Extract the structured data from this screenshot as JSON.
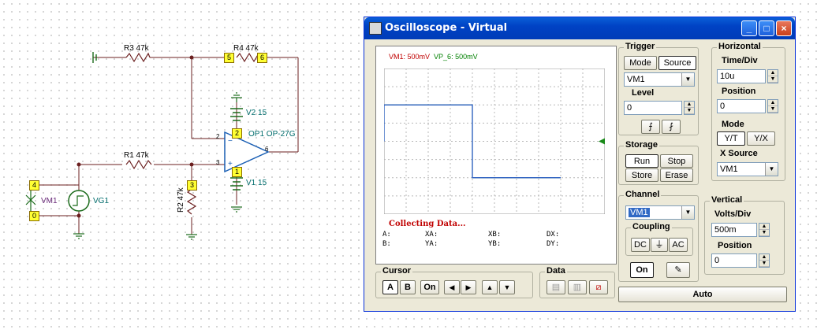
{
  "schematic": {
    "r3": "R3 47k",
    "r4": "R4 47k",
    "r1": "R1 47k",
    "r2": "R2 47k",
    "v2": "V2 15",
    "v1": "V1 15",
    "op1": "OP1 OP-27G",
    "vm1": "VM1",
    "vg1": "VG1",
    "nodes": {
      "n5": "5",
      "n6": "6",
      "n2": "2",
      "n1": "1",
      "n3": "3",
      "n4": "4",
      "n0": "0"
    },
    "pins": {
      "p2": "2",
      "p3": "3",
      "p6": "6"
    }
  },
  "window": {
    "title": "Oscilloscope - Virtual",
    "controls": {
      "minimize": "_",
      "maximize": "□",
      "close": "×"
    }
  },
  "screen": {
    "ch1": "VM1: 500mV",
    "ch2": "VP_6: 500mV",
    "status": "Collecting Data...",
    "cursors": {
      "a": "A:",
      "b": "B:",
      "xa": "XA:",
      "ya": "YA:",
      "xb": "XB:",
      "yb": "YB:",
      "dx": "DX:",
      "dy": "DY:"
    }
  },
  "trigger": {
    "title": "Trigger",
    "mode_label": "Mode",
    "source_label": "Source",
    "source_value": "VM1",
    "level_label": "Level",
    "level_value": "0",
    "rise_symbol": "⨍",
    "fall_symbol": "⨏"
  },
  "horizontal": {
    "title": "Horizontal",
    "timediv_label": "Time/Div",
    "timediv_value": "10u",
    "position_label": "Position",
    "position_value": "0",
    "mode_label": "Mode",
    "yt_label": "Y/T",
    "yx_label": "Y/X",
    "xsource_label": "X Source",
    "xsource_value": "VM1"
  },
  "storage": {
    "title": "Storage",
    "run": "Run",
    "stop": "Stop",
    "store": "Store",
    "erase": "Erase"
  },
  "channel": {
    "title": "Channel",
    "value": "VM1",
    "coupling_title": "Coupling",
    "dc": "DC",
    "gnd": "⏚",
    "ac": "AC",
    "on": "On",
    "pen": "✎"
  },
  "vertical": {
    "title": "Vertical",
    "voltsdiv_label": "Volts/Div",
    "voltsdiv_value": "500m",
    "position_label": "Position",
    "position_value": "0"
  },
  "cursor": {
    "title": "Cursor",
    "a": "A",
    "b": "B",
    "on": "On",
    "left": "◀",
    "right": "▶",
    "up": "▲",
    "down": "▼"
  },
  "data": {
    "title": "Data"
  },
  "auto": "Auto",
  "colors": {
    "trace1": "#2a5ad0",
    "trace2": "#2a8a2a",
    "title_bar": "#0042c4",
    "accent": "#c00000"
  },
  "chart_data": {
    "type": "line",
    "series": [
      {
        "x": [
          0,
          0,
          28,
          28,
          56
        ],
        "values": [
          0,
          1,
          1,
          -1,
          -1
        ]
      },
      {
        "x": [
          0,
          0,
          28,
          28,
          56
        ],
        "values": [
          0,
          1,
          1,
          -1,
          -1
        ]
      }
    ],
    "grid": true
  }
}
